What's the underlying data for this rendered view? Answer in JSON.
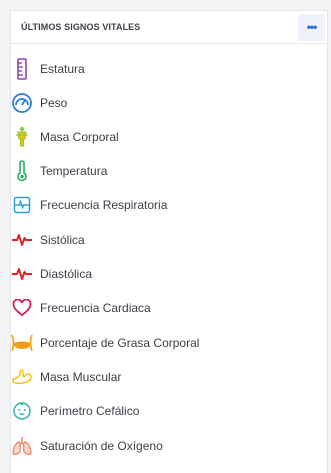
{
  "widget": {
    "title": "ÚLTIMOS SIGNOS VITALES",
    "more_label": "•••"
  },
  "vitals": [
    {
      "label": "Estatura",
      "icon": "ruler-icon",
      "color": "#8e44ad"
    },
    {
      "label": "Peso",
      "icon": "scale-gauge-icon",
      "color": "#2a7fd4"
    },
    {
      "label": "Masa Corporal",
      "icon": "body-mass-icon",
      "color": "#8cc63f"
    },
    {
      "label": "Temperatura",
      "icon": "thermometer-icon",
      "color": "#27ae60"
    },
    {
      "label": "Frecuencia Respiratoria",
      "icon": "respiratory-monitor-icon",
      "color": "#2a9fd6"
    },
    {
      "label": "Sistólica",
      "icon": "heartbeat-pulse-icon",
      "color": "#e0202a"
    },
    {
      "label": "Diastólica",
      "icon": "heartbeat-pulse-icon",
      "color": "#e0202a"
    },
    {
      "label": "Frecuencia Cardiaca",
      "icon": "heart-outline-icon",
      "color": "#d81b60"
    },
    {
      "label": "Porcentaje de Grasa Corporal",
      "icon": "waist-fat-icon",
      "color": "#f39c12"
    },
    {
      "label": "Masa Muscular",
      "icon": "flexed-arm-icon",
      "color": "#f1c40f"
    },
    {
      "label": "Perímetro Cefálico",
      "icon": "baby-head-icon",
      "color": "#2fb5a8"
    },
    {
      "label": "Saturación de Oxígeno",
      "icon": "lungs-icon",
      "color": "#e8806a"
    }
  ]
}
